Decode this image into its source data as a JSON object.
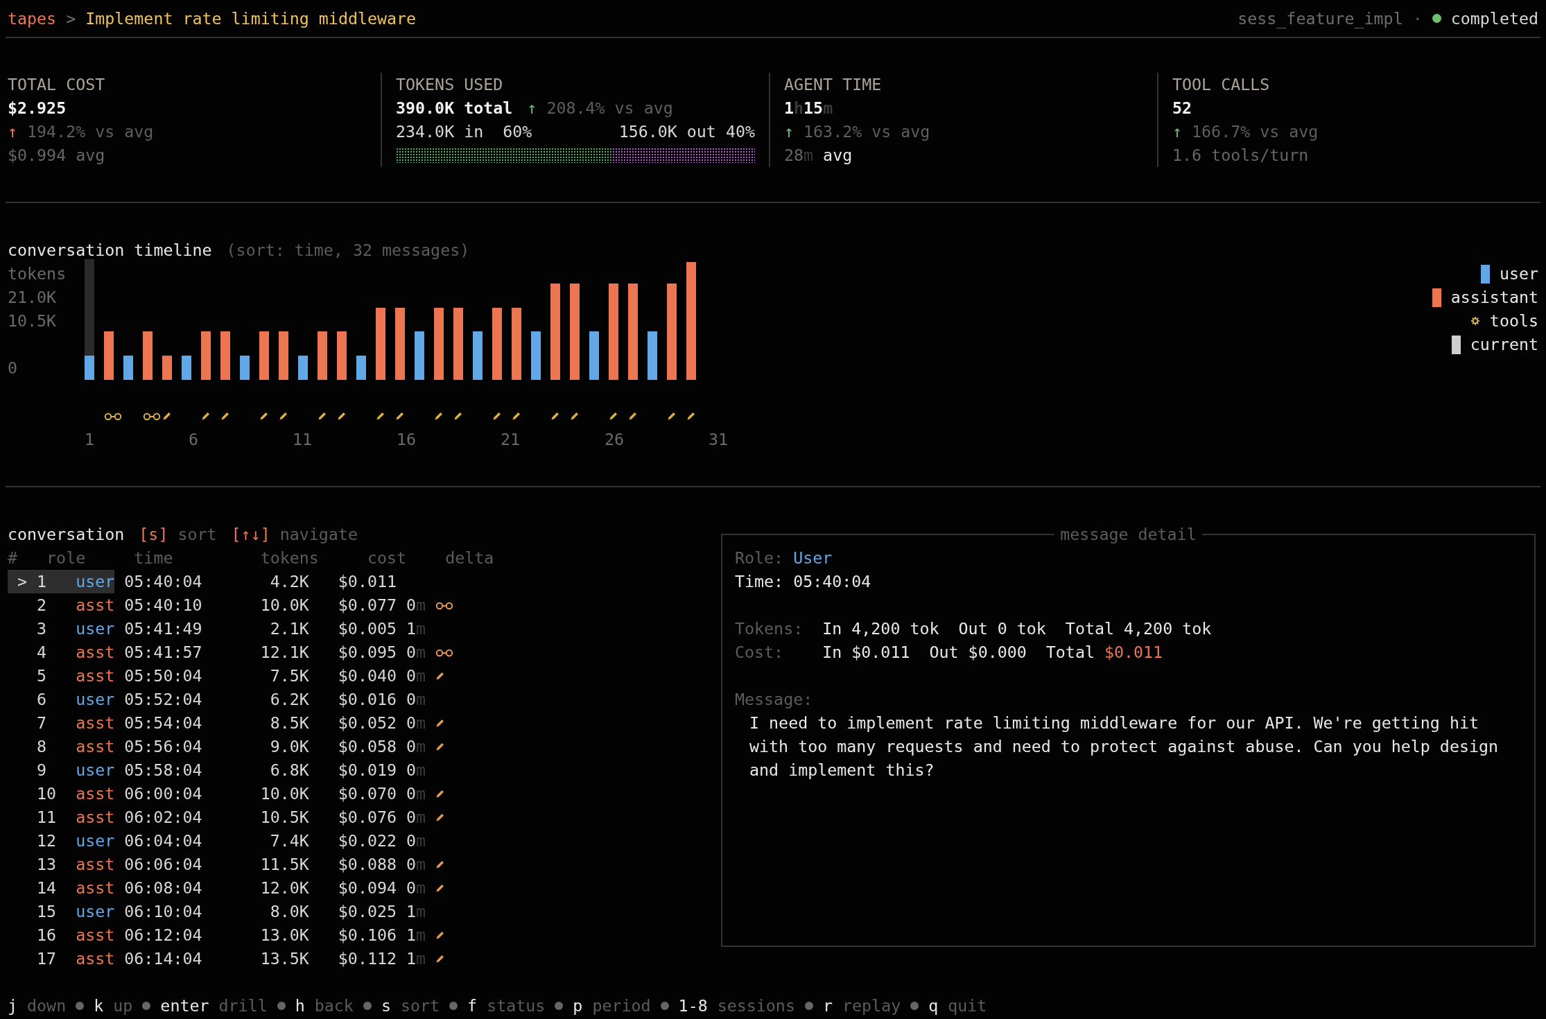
{
  "header": {
    "app": "tapes",
    "separator": ">",
    "title": "Implement rate limiting middleware",
    "session": "sess_feature_impl",
    "dot_separator": "·",
    "status": {
      "label": "completed",
      "color": "#6fbf73"
    }
  },
  "stats": [
    {
      "kind": "cost",
      "label": "TOTAL COST",
      "value": [
        {
          "text": "$2.925",
          "kind": "strong"
        }
      ],
      "trend": {
        "arrow": "↑",
        "color": "#ee7752",
        "text": "194.2% vs avg"
      },
      "footer": [
        {
          "text": "$0.994 avg",
          "kind": "muted"
        }
      ]
    },
    {
      "kind": "tokens",
      "label": "TOKENS USED",
      "value": [
        {
          "text": "390.0K total",
          "kind": "strong"
        }
      ],
      "trend": {
        "arrow": "↑",
        "color": "#6fbf73",
        "text": "208.4% vs avg"
      },
      "split": {
        "in_label": "234.0K in  60%",
        "out_label": "156.0K out 40%",
        "level": 0.6
      }
    },
    {
      "kind": "time",
      "label": "AGENT TIME",
      "value": [
        {
          "text": "1",
          "kind": "strong"
        },
        {
          "text": "h",
          "kind": "faint"
        },
        {
          "text": "15",
          "kind": "strong"
        },
        {
          "text": "m",
          "kind": "faint"
        }
      ],
      "trend": {
        "arrow": "↑",
        "color": "#6fbf73",
        "text": "163.2% vs avg"
      },
      "footer": [
        {
          "text": "28",
          "kind": "muted"
        },
        {
          "text": "m",
          "kind": "faint"
        },
        {
          "text": " avg",
          "kind": "plain"
        }
      ]
    },
    {
      "kind": "tools",
      "label": "TOOL CALLS",
      "value": [
        {
          "text": "52",
          "kind": "strong"
        }
      ],
      "trend": {
        "arrow": "↑",
        "color": "#6fbf73",
        "text": "166.7% vs avg"
      },
      "footer": [
        {
          "text": "1.6 tools/turn",
          "kind": "muted"
        }
      ]
    }
  ],
  "timeline": {
    "title": "conversation timeline",
    "subtitle": "(sort: time, 32 messages)",
    "axis_label": "tokens",
    "y_labels": [
      "21.0K",
      "10.5K",
      "0"
    ],
    "bars": [
      {
        "kind": "user",
        "level": 0.2,
        "current": true
      },
      {
        "kind": "assistant",
        "level": 0.4,
        "current": false,
        "tool": {
          "kind": "read"
        }
      },
      {
        "kind": "user",
        "level": 0.2,
        "current": false
      },
      {
        "kind": "assistant",
        "level": 0.4,
        "current": false,
        "tool": {
          "kind": "read"
        }
      },
      {
        "kind": "assistant",
        "level": 0.2,
        "current": false,
        "tool": {
          "kind": "edit"
        }
      },
      {
        "kind": "user",
        "level": 0.2,
        "current": false
      },
      {
        "kind": "assistant",
        "level": 0.4,
        "current": false,
        "tool": {
          "kind": "edit"
        }
      },
      {
        "kind": "assistant",
        "level": 0.4,
        "current": false,
        "tool": {
          "kind": "edit"
        }
      },
      {
        "kind": "user",
        "level": 0.2,
        "current": false
      },
      {
        "kind": "assistant",
        "level": 0.4,
        "current": false,
        "tool": {
          "kind": "edit"
        }
      },
      {
        "kind": "assistant",
        "level": 0.4,
        "current": false,
        "tool": {
          "kind": "edit"
        }
      },
      {
        "kind": "user",
        "level": 0.2,
        "current": false
      },
      {
        "kind": "assistant",
        "level": 0.4,
        "current": false,
        "tool": {
          "kind": "edit"
        }
      },
      {
        "kind": "assistant",
        "level": 0.4,
        "current": false,
        "tool": {
          "kind": "edit"
        }
      },
      {
        "kind": "user",
        "level": 0.2,
        "current": false
      },
      {
        "kind": "assistant",
        "level": 0.6,
        "current": false,
        "tool": {
          "kind": "edit"
        }
      },
      {
        "kind": "assistant",
        "level": 0.6,
        "current": false,
        "tool": {
          "kind": "edit"
        }
      },
      {
        "kind": "user",
        "level": 0.4,
        "current": false
      },
      {
        "kind": "assistant",
        "level": 0.6,
        "current": false,
        "tool": {
          "kind": "edit"
        }
      },
      {
        "kind": "assistant",
        "level": 0.6,
        "current": false,
        "tool": {
          "kind": "edit"
        }
      },
      {
        "kind": "user",
        "level": 0.4,
        "current": false
      },
      {
        "kind": "assistant",
        "level": 0.6,
        "current": false,
        "tool": {
          "kind": "edit"
        }
      },
      {
        "kind": "assistant",
        "level": 0.6,
        "current": false,
        "tool": {
          "kind": "edit"
        }
      },
      {
        "kind": "user",
        "level": 0.4,
        "current": false
      },
      {
        "kind": "assistant",
        "level": 0.8,
        "current": false,
        "tool": {
          "kind": "edit"
        }
      },
      {
        "kind": "assistant",
        "level": 0.8,
        "current": false,
        "tool": {
          "kind": "edit"
        }
      },
      {
        "kind": "user",
        "level": 0.4,
        "current": false
      },
      {
        "kind": "assistant",
        "level": 0.8,
        "current": false,
        "tool": {
          "kind": "edit"
        }
      },
      {
        "kind": "assistant",
        "level": 0.8,
        "current": false,
        "tool": {
          "kind": "edit"
        }
      },
      {
        "kind": "user",
        "level": 0.4,
        "current": false
      },
      {
        "kind": "assistant",
        "level": 0.8,
        "current": false,
        "tool": {
          "kind": "edit"
        }
      },
      {
        "kind": "assistant",
        "level": 1.0,
        "current": false,
        "tool": {
          "kind": "edit"
        }
      }
    ],
    "x_labels": [
      "1",
      "6",
      "11",
      "16",
      "21",
      "26",
      "31"
    ],
    "legend": [
      {
        "kind": "user",
        "label": "user"
      },
      {
        "kind": "assistant",
        "label": "assistant"
      },
      {
        "kind": "tools",
        "label": "tools"
      },
      {
        "kind": "current",
        "label": "current"
      }
    ]
  },
  "conversation": {
    "title": "conversation",
    "cursor": ">",
    "hints": [
      {
        "key": "[s]",
        "label": "sort"
      },
      {
        "key": "[↑↓]",
        "label": "navigate"
      }
    ],
    "columns": [
      "#",
      "role",
      "time",
      "tokens",
      "cost",
      "delta"
    ],
    "rows": [
      {
        "selected": true,
        "num": "1",
        "role": "user",
        "kind": "user",
        "time": "05:40:04",
        "tokens": "4.2K",
        "cost": "$0.011"
      },
      {
        "selected": false,
        "num": "2",
        "role": "asst",
        "kind": "assistant",
        "time": "05:40:10",
        "tokens": "10.0K",
        "cost": "$0.077",
        "delta": {
          "value": "0",
          "unit": "m"
        },
        "tool": {
          "kind": "read"
        }
      },
      {
        "selected": false,
        "num": "3",
        "role": "user",
        "kind": "user",
        "time": "05:41:49",
        "tokens": "2.1K",
        "cost": "$0.005",
        "delta": {
          "value": "1",
          "unit": "m"
        }
      },
      {
        "selected": false,
        "num": "4",
        "role": "asst",
        "kind": "assistant",
        "time": "05:41:57",
        "tokens": "12.1K",
        "cost": "$0.095",
        "delta": {
          "value": "0",
          "unit": "m"
        },
        "tool": {
          "kind": "read"
        }
      },
      {
        "selected": false,
        "num": "5",
        "role": "asst",
        "kind": "assistant",
        "time": "05:50:04",
        "tokens": "7.5K",
        "cost": "$0.040",
        "delta": {
          "value": "0",
          "unit": "m"
        },
        "tool": {
          "kind": "edit"
        }
      },
      {
        "selected": false,
        "num": "6",
        "role": "user",
        "kind": "user",
        "time": "05:52:04",
        "tokens": "6.2K",
        "cost": "$0.016",
        "delta": {
          "value": "0",
          "unit": "m"
        }
      },
      {
        "selected": false,
        "num": "7",
        "role": "asst",
        "kind": "assistant",
        "time": "05:54:04",
        "tokens": "8.5K",
        "cost": "$0.052",
        "delta": {
          "value": "0",
          "unit": "m"
        },
        "tool": {
          "kind": "edit"
        }
      },
      {
        "selected": false,
        "num": "8",
        "role": "asst",
        "kind": "assistant",
        "time": "05:56:04",
        "tokens": "9.0K",
        "cost": "$0.058",
        "delta": {
          "value": "0",
          "unit": "m"
        },
        "tool": {
          "kind": "edit"
        }
      },
      {
        "selected": false,
        "num": "9",
        "role": "user",
        "kind": "user",
        "time": "05:58:04",
        "tokens": "6.8K",
        "cost": "$0.019",
        "delta": {
          "value": "0",
          "unit": "m"
        }
      },
      {
        "selected": false,
        "num": "10",
        "role": "asst",
        "kind": "assistant",
        "time": "06:00:04",
        "tokens": "10.0K",
        "cost": "$0.070",
        "delta": {
          "value": "0",
          "unit": "m"
        },
        "tool": {
          "kind": "edit"
        }
      },
      {
        "selected": false,
        "num": "11",
        "role": "asst",
        "kind": "assistant",
        "time": "06:02:04",
        "tokens": "10.5K",
        "cost": "$0.076",
        "delta": {
          "value": "0",
          "unit": "m"
        },
        "tool": {
          "kind": "edit"
        }
      },
      {
        "selected": false,
        "num": "12",
        "role": "user",
        "kind": "user",
        "time": "06:04:04",
        "tokens": "7.4K",
        "cost": "$0.022",
        "delta": {
          "value": "0",
          "unit": "m"
        }
      },
      {
        "selected": false,
        "num": "13",
        "role": "asst",
        "kind": "assistant",
        "time": "06:06:04",
        "tokens": "11.5K",
        "cost": "$0.088",
        "delta": {
          "value": "0",
          "unit": "m"
        },
        "tool": {
          "kind": "edit"
        }
      },
      {
        "selected": false,
        "num": "14",
        "role": "asst",
        "kind": "assistant",
        "time": "06:08:04",
        "tokens": "12.0K",
        "cost": "$0.094",
        "delta": {
          "value": "0",
          "unit": "m"
        },
        "tool": {
          "kind": "edit"
        }
      },
      {
        "selected": false,
        "num": "15",
        "role": "user",
        "kind": "user",
        "time": "06:10:04",
        "tokens": "8.0K",
        "cost": "$0.025",
        "delta": {
          "value": "1",
          "unit": "m"
        }
      },
      {
        "selected": false,
        "num": "16",
        "role": "asst",
        "kind": "assistant",
        "time": "06:12:04",
        "tokens": "13.0K",
        "cost": "$0.106",
        "delta": {
          "value": "1",
          "unit": "m"
        },
        "tool": {
          "kind": "edit"
        }
      },
      {
        "selected": false,
        "num": "17",
        "role": "asst",
        "kind": "assistant",
        "time": "06:14:04",
        "tokens": "13.5K",
        "cost": "$0.112",
        "delta": {
          "value": "1",
          "unit": "m"
        },
        "tool": {
          "kind": "edit"
        }
      }
    ]
  },
  "detail": {
    "title": "message detail",
    "role": {
      "label": "Role:",
      "value": "User",
      "kind": "user"
    },
    "time": {
      "label": "Time:",
      "value": "05:40:04"
    },
    "tokens": {
      "label": "Tokens:",
      "value": "In 4,200 tok  Out 0 tok  Total 4,200 tok"
    },
    "cost": {
      "label": "Cost:",
      "value": "In $0.011  Out $0.000  Total",
      "total": "$0.011"
    },
    "message": {
      "label": "Message:",
      "text": "I need to implement rate limiting middleware for our API. We're getting hit with too many requests and need to protect against abuse. Can you help design and implement this?"
    }
  },
  "footer": [
    {
      "key": "j",
      "action": "down"
    },
    {
      "key": "k",
      "action": "up"
    },
    {
      "key": "enter",
      "action": "drill"
    },
    {
      "key": "h",
      "action": "back"
    },
    {
      "key": "s",
      "action": "sort"
    },
    {
      "key": "f",
      "action": "status"
    },
    {
      "key": "p",
      "action": "period"
    },
    {
      "key": "1-8",
      "action": "sessions"
    },
    {
      "key": "r",
      "action": "replay"
    },
    {
      "key": "q",
      "action": "quit"
    }
  ]
}
